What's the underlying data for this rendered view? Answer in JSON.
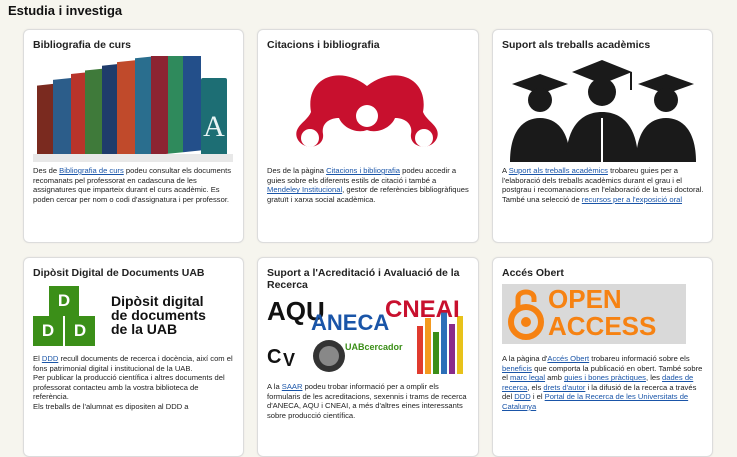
{
  "section_title": "Estudia i investiga",
  "colors": {
    "accent_red": "#c8102e",
    "link": "#1a55a8",
    "uab_green": "#3b8f18",
    "oa_orange": "#f68212"
  },
  "cards": [
    {
      "title": "Bibliografia de curs",
      "image_icon": "books-icon",
      "text": [
        {
          "t": "Des de "
        },
        {
          "link": "Bibliografia de curs"
        },
        {
          "t": " podeu consultar els documents recomanats pel professorat en cadascuna de les assignatures que imparteix durant el curs acadèmic. Es poden cercar per nom o codi d'assignatura i per professor."
        }
      ]
    },
    {
      "title": "Citacions i bibliografia",
      "image_icon": "mendeley-logo-icon",
      "text": [
        {
          "t": "Des de la pàgina  "
        },
        {
          "link": "Citacions i bibliografia"
        },
        {
          "t": " podeu accedir a guies sobre els diferents estils de citació i també a "
        },
        {
          "link": "Mendeley Institucional"
        },
        {
          "t": ", gestor de referències bibliogràfiques gratuït i xarxa social acadèmica."
        }
      ]
    },
    {
      "title": "Suport als treballs acadèmics",
      "image_icon": "graduates-icon",
      "text": [
        {
          "t": "A "
        },
        {
          "link": "Suport als treballs acadèmics"
        },
        {
          "t": " trobareu guies per a l'elaboració dels treballs acadèmics durant el grau i el postgrau i recomanacions en l'elaboració de la tesi doctoral. També una selecció de  "
        },
        {
          "link": "recursos per a l'exposició oral"
        }
      ]
    },
    {
      "title": "Dipòsit Digital de Documents UAB",
      "image_icon": "ddd-logo-icon",
      "logo_text": [
        "Dipòsit digital",
        "de documents",
        "de la UAB"
      ],
      "logo_letters": [
        "D",
        "D",
        "D"
      ],
      "text": [
        {
          "t": "El "
        },
        {
          "link": "DDD"
        },
        {
          "t": " recull documents de recerca i docència, així com el fons patrimonial digital i institucional de la UAB."
        },
        {
          "br": true
        },
        {
          "t": "Per publicar la producció científica i altres documents del professorat contacteu amb la vostra biblioteca de referència."
        },
        {
          "br": true
        },
        {
          "t": "Els treballs de l'alumnat es dipositen al DDD a"
        }
      ]
    },
    {
      "title": "Suport a l'Acreditació i Avaluació de la Recerca",
      "image_icon": "accreditation-collage-icon",
      "collage_words": [
        "AQU",
        "CNEAI",
        "ANECA",
        "UABcercador",
        "C",
        "V"
      ],
      "text": [
        {
          "t": "A la "
        },
        {
          "link": "SAAR"
        },
        {
          "t": " podeu trobar informació per a omplir els formularis de les acreditacions, sexennis i trams de recerca d'ANECA, AQU i CNEAI, a més d'altres eines interessants sobre producció científica."
        }
      ]
    },
    {
      "title": "Accés Obert",
      "image_icon": "open-access-logo-icon",
      "logo_text": [
        "OPEN",
        "ACCESS"
      ],
      "text": [
        {
          "t": "A la pàgina d'"
        },
        {
          "link": "Accés Obert"
        },
        {
          "t": " trobareu informació sobre els "
        },
        {
          "link": "beneficis"
        },
        {
          "t": " que comporta la publicació en obert. També sobre el "
        },
        {
          "link": "marc legal"
        },
        {
          "t": " amb "
        },
        {
          "link": "guies i bones pràctiques"
        },
        {
          "t": ", les "
        },
        {
          "link": "dades de recerca"
        },
        {
          "t": ", els "
        },
        {
          "link": "drets d'autor"
        },
        {
          "t": " i la difusió de la recerca a través del "
        },
        {
          "link": "DDD"
        },
        {
          "t": " i el "
        },
        {
          "link": "Portal de la Recerca de les Universitats de Catalunya"
        }
      ]
    }
  ]
}
